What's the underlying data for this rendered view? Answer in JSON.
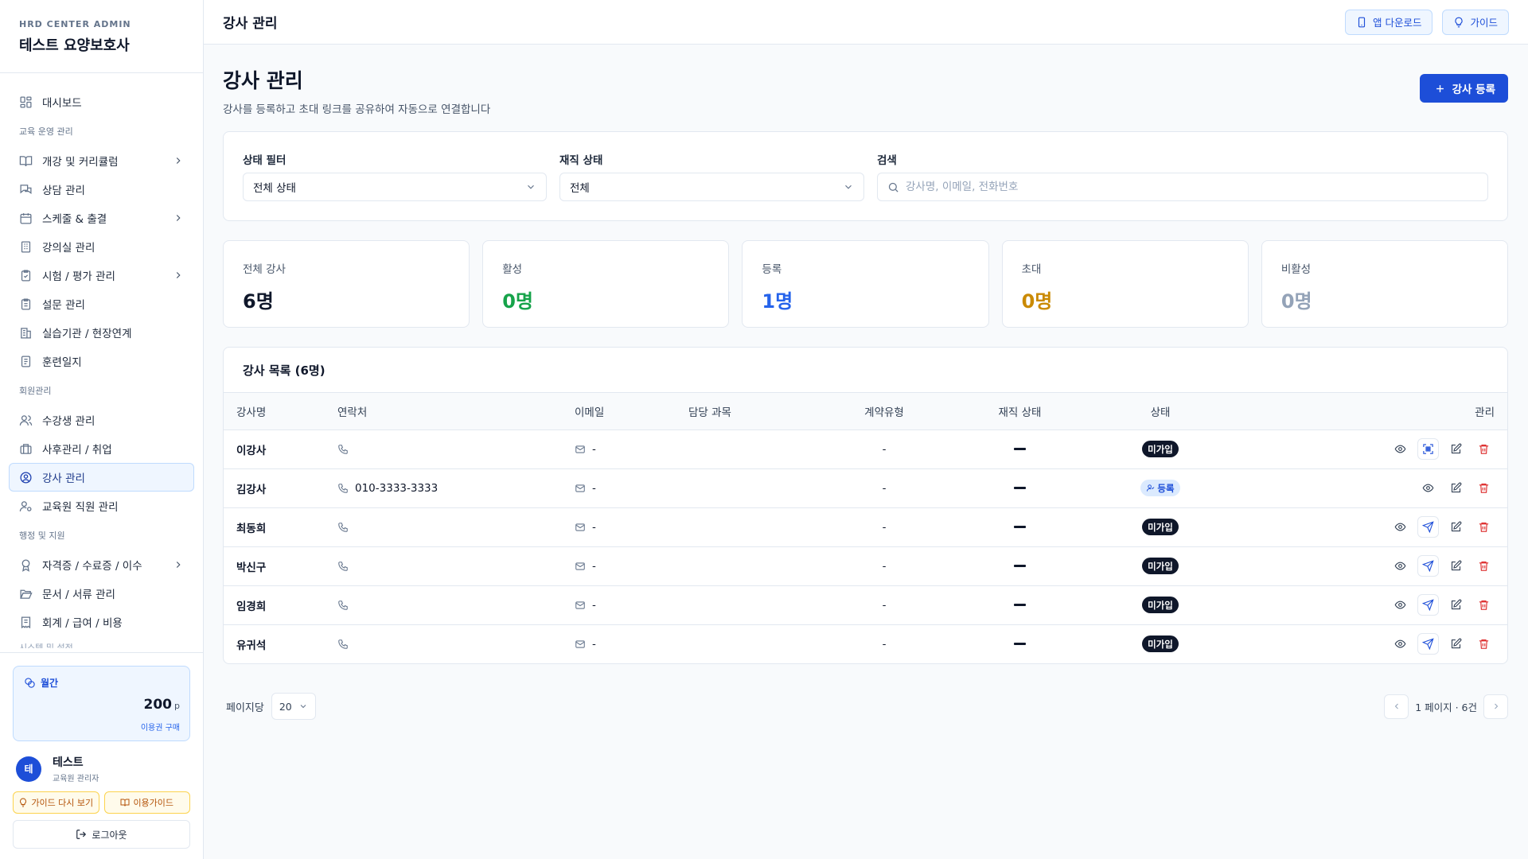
{
  "brand": {
    "sub": "HRD CENTER ADMIN",
    "title": "테스트 요양보호사"
  },
  "nav": {
    "dashboard": "대시보드",
    "section1": "교육 운영 관리",
    "item_course": "개강 및 커리큘럼",
    "item_consult": "상담 관리",
    "item_schedule": "스케줄 & 출결",
    "item_room": "강의실 관리",
    "item_exam": "시험 / 평가 관리",
    "item_survey": "설문 관리",
    "item_practice": "실습기관 / 현장연계",
    "item_journal": "훈련일지",
    "section2": "회원관리",
    "item_students": "수강생 관리",
    "item_aftercare": "사후관리 / 취업",
    "item_instructors": "강사 관리",
    "item_staff": "교육원 직원 관리",
    "section3": "행정 및 지원",
    "item_cert": "자격증 / 수료증 / 이수",
    "item_docs": "문서 / 서류 관리",
    "item_accounting": "회계 / 급여 / 비용",
    "section4": "시스템 및 설정"
  },
  "credit": {
    "label": "월간",
    "amount": "200",
    "unit": "p",
    "link": "이용권 구매"
  },
  "user": {
    "avatar": "테",
    "name": "테스트",
    "role": "교육원 관리자"
  },
  "guide": {
    "replay": "가이드 다시 보기",
    "manual": "이용가이드"
  },
  "logout": "로그아웃",
  "topbar": {
    "title": "강사 관리",
    "app_download": "앱 다운로드",
    "guide": "가이드"
  },
  "page": {
    "title": "강사 관리",
    "desc": "강사를 등록하고 초대 링크를 공유하여 자동으로 연결합니다",
    "register_btn": "강사 등록"
  },
  "filters": {
    "status_label": "상태 필터",
    "status_value": "전체 상태",
    "employ_label": "재직 상태",
    "employ_value": "전체",
    "search_label": "검색",
    "search_placeholder": "강사명, 이메일, 전화번호"
  },
  "stats": [
    {
      "label": "전체 강사",
      "value": "6명",
      "color": "#0f172a"
    },
    {
      "label": "활성",
      "value": "0명",
      "color": "#16a34a"
    },
    {
      "label": "등록",
      "value": "1명",
      "color": "#2563eb"
    },
    {
      "label": "초대",
      "value": "0명",
      "color": "#ca8a04"
    },
    {
      "label": "비활성",
      "value": "0명",
      "color": "#94a3b8"
    }
  ],
  "list": {
    "title": "강사 목록 (6명)",
    "columns": [
      "강사명",
      "연락처",
      "이메일",
      "담당 과목",
      "계약유형",
      "재직 상태",
      "상태",
      "관리"
    ],
    "rows": [
      {
        "name": "이강사",
        "phone": "",
        "email": "-",
        "subject": "",
        "contract": "-",
        "status": "미가입",
        "status_type": "unregistered"
      },
      {
        "name": "김강사",
        "phone": "010-3333-3333",
        "email": "-",
        "subject": "",
        "contract": "-",
        "status": "등록",
        "status_type": "registered"
      },
      {
        "name": "최동희",
        "phone": "",
        "email": "-",
        "subject": "",
        "contract": "-",
        "status": "미가입",
        "status_type": "unregistered"
      },
      {
        "name": "박신구",
        "phone": "",
        "email": "-",
        "subject": "",
        "contract": "-",
        "status": "미가입",
        "status_type": "unregistered"
      },
      {
        "name": "임경희",
        "phone": "",
        "email": "-",
        "subject": "",
        "contract": "-",
        "status": "미가입",
        "status_type": "unregistered"
      },
      {
        "name": "유귀석",
        "phone": "",
        "email": "-",
        "subject": "",
        "contract": "-",
        "status": "미가입",
        "status_type": "unregistered"
      }
    ]
  },
  "pager": {
    "per_page_label": "페이지당",
    "per_page_value": "20",
    "info": "1 페이지 · 6건"
  },
  "icons": {
    "view": "eye-icon",
    "qr": "qr-code-icon",
    "send": "send-icon",
    "edit": "edit-icon",
    "delete": "trash-icon",
    "phone": "phone-icon",
    "mail": "mail-icon"
  },
  "colors": {
    "accent": "#1d4ed8",
    "danger": "#dc2626",
    "badge_dark": "#0f172a"
  }
}
